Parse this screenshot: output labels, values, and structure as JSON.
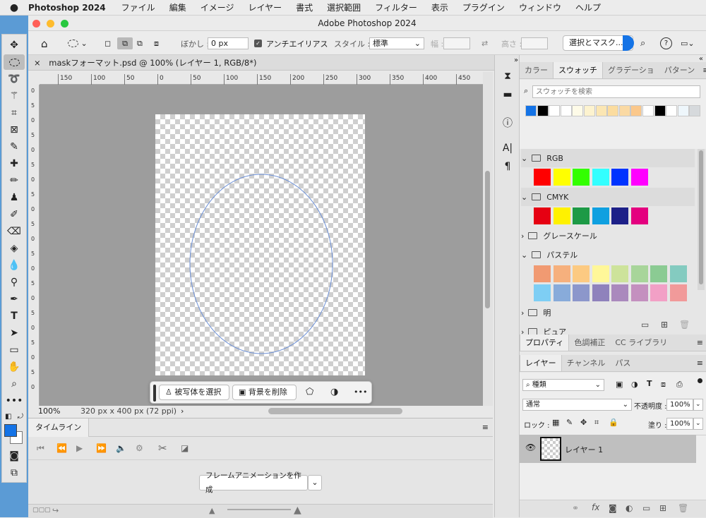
{
  "menubar": {
    "app": "Photoshop 2024",
    "items": [
      "ファイル",
      "編集",
      "イメージ",
      "レイヤー",
      "書式",
      "選択範囲",
      "フィルター",
      "表示",
      "プラグイン",
      "ウィンドウ",
      "ヘルプ"
    ]
  },
  "window": {
    "title": "Adobe Photoshop 2024"
  },
  "options": {
    "feather_label": "ぼかし :",
    "feather_value": "0 px",
    "antialias_label": "アンチエイリアス",
    "style_label": "スタイル :",
    "style_value": "標準",
    "width_label": "幅 :",
    "height_label": "高さ :",
    "select_mask": "選択とマスク..."
  },
  "doc": {
    "tab": "maskフォーマット.psd @ 100% (レイヤー 1, RGB/8*)",
    "zoom": "100%",
    "info": "320 px x 400 px (72 ppi)"
  },
  "ruler": {
    "top": [
      "150",
      "100",
      "50",
      "0",
      "50",
      "100",
      "150",
      "200",
      "250",
      "300",
      "350",
      "400",
      "450"
    ],
    "left": [
      "0",
      "5",
      "0",
      "5",
      "0",
      "5",
      "0",
      "5",
      "0",
      "5",
      "0",
      "5",
      "0",
      "5",
      "0",
      "5",
      "0",
      "5",
      "0",
      "5",
      "0"
    ]
  },
  "context": {
    "select_subject": "被写体を選択",
    "remove_bg": "背景を削除",
    "more": "•••"
  },
  "timeline": {
    "title": "タイムライン",
    "create_frames": "フレームアニメーションを作成"
  },
  "swatches": {
    "tabs": [
      "カラー",
      "スウォッチ",
      "グラデーショ",
      "パターン"
    ],
    "search_placeholder": "スウォッチを検索",
    "recent": [
      "#1473e6",
      "#000000",
      "#ffffff",
      "#ffffff",
      "#fefbe8",
      "#fdf3cf",
      "#fbe6b3",
      "#fbdc9f",
      "#fad9a3",
      "#fbc88b",
      "#ffffff",
      "#000000",
      "#ffffff",
      "#eef6fb",
      "#d6d9dc"
    ],
    "groups": [
      {
        "name": "RGB",
        "colors": [
          "#ff0000",
          "#ffff00",
          "#33ff00",
          "#33ffff",
          "#0033ff",
          "#ff00ff"
        ]
      },
      {
        "name": "CMYK",
        "colors": [
          "#e60012",
          "#fff100",
          "#1d9a46",
          "#0fa0e0",
          "#1d2088",
          "#e4007f"
        ]
      },
      {
        "name": "グレースケール",
        "colors": []
      },
      {
        "name": "パステル",
        "colors": [
          "#f19a72",
          "#f6b07d",
          "#fcca82",
          "#fff799",
          "#cde39b",
          "#a8d59a",
          "#8bcb93",
          "#84cbc0",
          "#7ecef4",
          "#88abda",
          "#8c97cb",
          "#8f82bc",
          "#aa89bd",
          "#c490bf",
          "#f2a0c6",
          "#f19a9a"
        ]
      },
      {
        "name": "明",
        "colors": []
      },
      {
        "name": "ピュア",
        "colors": []
      }
    ]
  },
  "props": {
    "tabs": [
      "プロパティ",
      "色調補正",
      "CC ライブラリ"
    ]
  },
  "layers": {
    "tabs": [
      "レイヤー",
      "チャンネル",
      "パス"
    ],
    "kind": "種類",
    "blend": "通常",
    "opacity_label": "不透明度 :",
    "opacity": "100%",
    "lock_label": "ロック :",
    "fill_label": "塗り :",
    "fill": "100%",
    "items": [
      {
        "name": "レイヤー 1",
        "visible": true
      }
    ]
  },
  "colors": {
    "foreground": "#1473e6",
    "background": "#ffffff",
    "accent": "#1473e6"
  }
}
